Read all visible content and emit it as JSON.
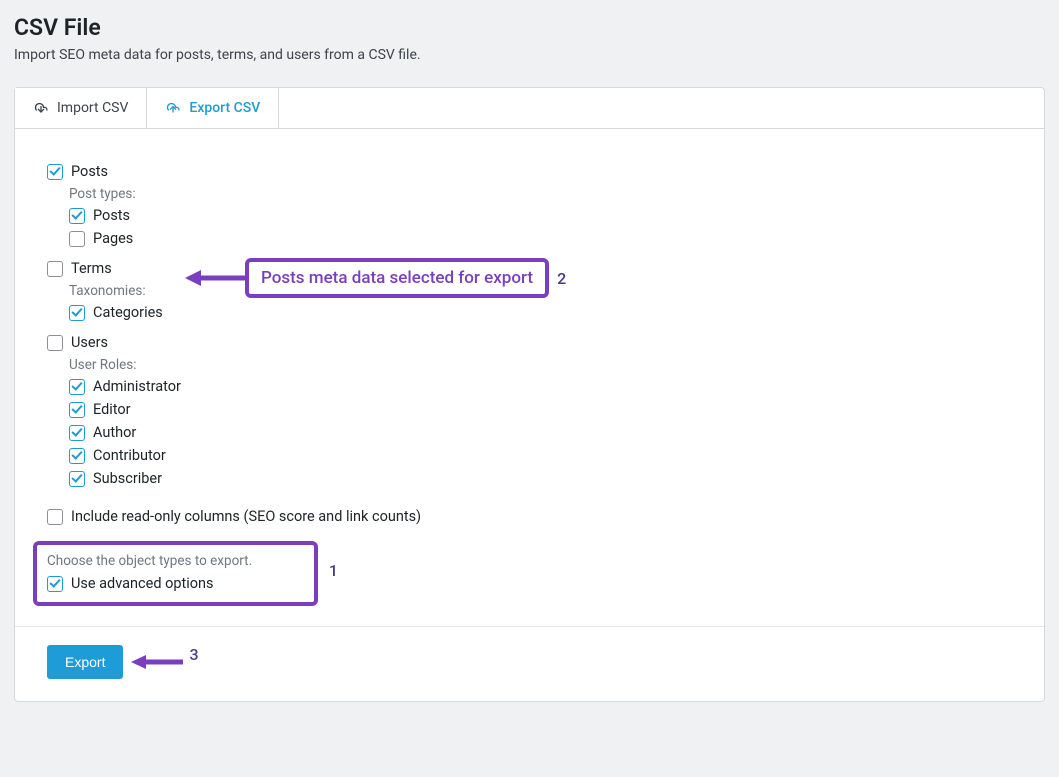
{
  "page": {
    "title": "CSV File",
    "description": "Import SEO meta data for posts, terms, and users from a CSV file."
  },
  "tabs": {
    "import": {
      "label": "Import CSV"
    },
    "export": {
      "label": "Export CSV"
    }
  },
  "sections": {
    "posts": {
      "label": "Posts",
      "checked": true,
      "sublabel": "Post types:",
      "items": [
        {
          "label": "Posts",
          "checked": true
        },
        {
          "label": "Pages",
          "checked": false
        }
      ]
    },
    "terms": {
      "label": "Terms",
      "checked": false,
      "sublabel": "Taxonomies:",
      "items": [
        {
          "label": "Categories",
          "checked": true
        }
      ]
    },
    "users": {
      "label": "Users",
      "checked": false,
      "sublabel": "User Roles:",
      "items": [
        {
          "label": "Administrator",
          "checked": true
        },
        {
          "label": "Editor",
          "checked": true
        },
        {
          "label": "Author",
          "checked": true
        },
        {
          "label": "Contributor",
          "checked": true
        },
        {
          "label": "Subscriber",
          "checked": true
        }
      ]
    }
  },
  "readonly": {
    "label": "Include read-only columns (SEO score and link counts)",
    "checked": false
  },
  "advanced": {
    "choose_label": "Choose the object types to export.",
    "option_label": "Use advanced options",
    "checked": true
  },
  "footer": {
    "export_label": "Export"
  },
  "annotations": {
    "callout_posts": "Posts meta data selected for export",
    "num_posts": "2",
    "num_advanced": "1",
    "num_export": "3"
  }
}
